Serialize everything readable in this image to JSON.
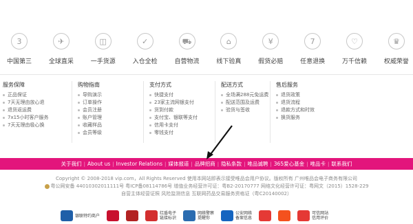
{
  "guarantees": [
    {
      "label": "中国第三",
      "icon": "3"
    },
    {
      "label": "全球直采",
      "icon": "✈"
    },
    {
      "label": "一手货源",
      "icon": "◫"
    },
    {
      "label": "入仓全检",
      "icon": "✓"
    },
    {
      "label": "自营物流",
      "icon": "⛟"
    },
    {
      "label": "线下验真",
      "icon": "⌂"
    },
    {
      "label": "假货必赔",
      "icon": "¥"
    },
    {
      "label": "任意退换",
      "icon": "7"
    },
    {
      "label": "万千信赖",
      "icon": "♡"
    },
    {
      "label": "权威荣誉",
      "icon": "♛"
    }
  ],
  "help_columns": [
    {
      "title": "服务保障",
      "items": [
        "正品保证",
        "7天无理由放心退",
        "退货返运费",
        "7x15小时客户服务",
        "7天无理由极心换"
      ]
    },
    {
      "title": "购物指南",
      "items": [
        "导购演示",
        "订单操作",
        "会员注册",
        "账户管理",
        "收藏样品",
        "会员等级"
      ]
    },
    {
      "title": "支付方式",
      "items": [
        "快捷支付",
        "23家主流网银支付",
        "货到付款",
        "支付宝、银联等支付",
        "信用卡支付",
        "零钱支付"
      ]
    },
    {
      "title": "配送方式",
      "items": [
        "全场满288元免运费",
        "配送范围及运费",
        "验货与签收"
      ]
    },
    {
      "title": "售后服务",
      "items": [
        "退货政策",
        "退货流程",
        "退款方式和时效",
        "换货服务"
      ]
    }
  ],
  "footer_links": [
    "关于我们",
    "About us",
    "Investor Relations",
    "媒体报道",
    "品牌招商",
    "隐私条款",
    "唯品诚聘",
    "365爱心基金",
    "唯品卡",
    "联系我们"
  ],
  "copyright": {
    "line1": "Copyright © 2008-2018 vip.com，All Rights Reserved  使用本网站即表示接受唯品会用户协议。版权所有 广州唯品会电子商务有限公司",
    "line2": "粤公网安备 44010302011111号  粤ICP备08114786号 增值业务经营许可证：粤B2-20170777 网络文化经营许可证：粤网文（2015）1528-229",
    "line3": "自营主体经营证照  风险监测信息  互联网药品交易服务资格证（粤C20140002）"
  },
  "certificates": [
    {
      "label": "银联特约商户",
      "color": "#1f5fa8"
    },
    {
      "label": "",
      "color": "#c8102e"
    },
    {
      "label": "",
      "color": "#b22222"
    },
    {
      "label": "红盾电子\n链接标识",
      "color": "#d32f2f"
    },
    {
      "label": "网络警察\n提醒你",
      "color": "#2b6cb0"
    },
    {
      "label": "公安网络\n备案信息",
      "color": "#1565c0"
    },
    {
      "label": "",
      "color": "#e53935"
    },
    {
      "label": "",
      "color": "#f4511e"
    },
    {
      "label": "可信网站\n信用评价",
      "color": "#e53935"
    }
  ],
  "colors": {
    "accent": "#e3157c"
  }
}
